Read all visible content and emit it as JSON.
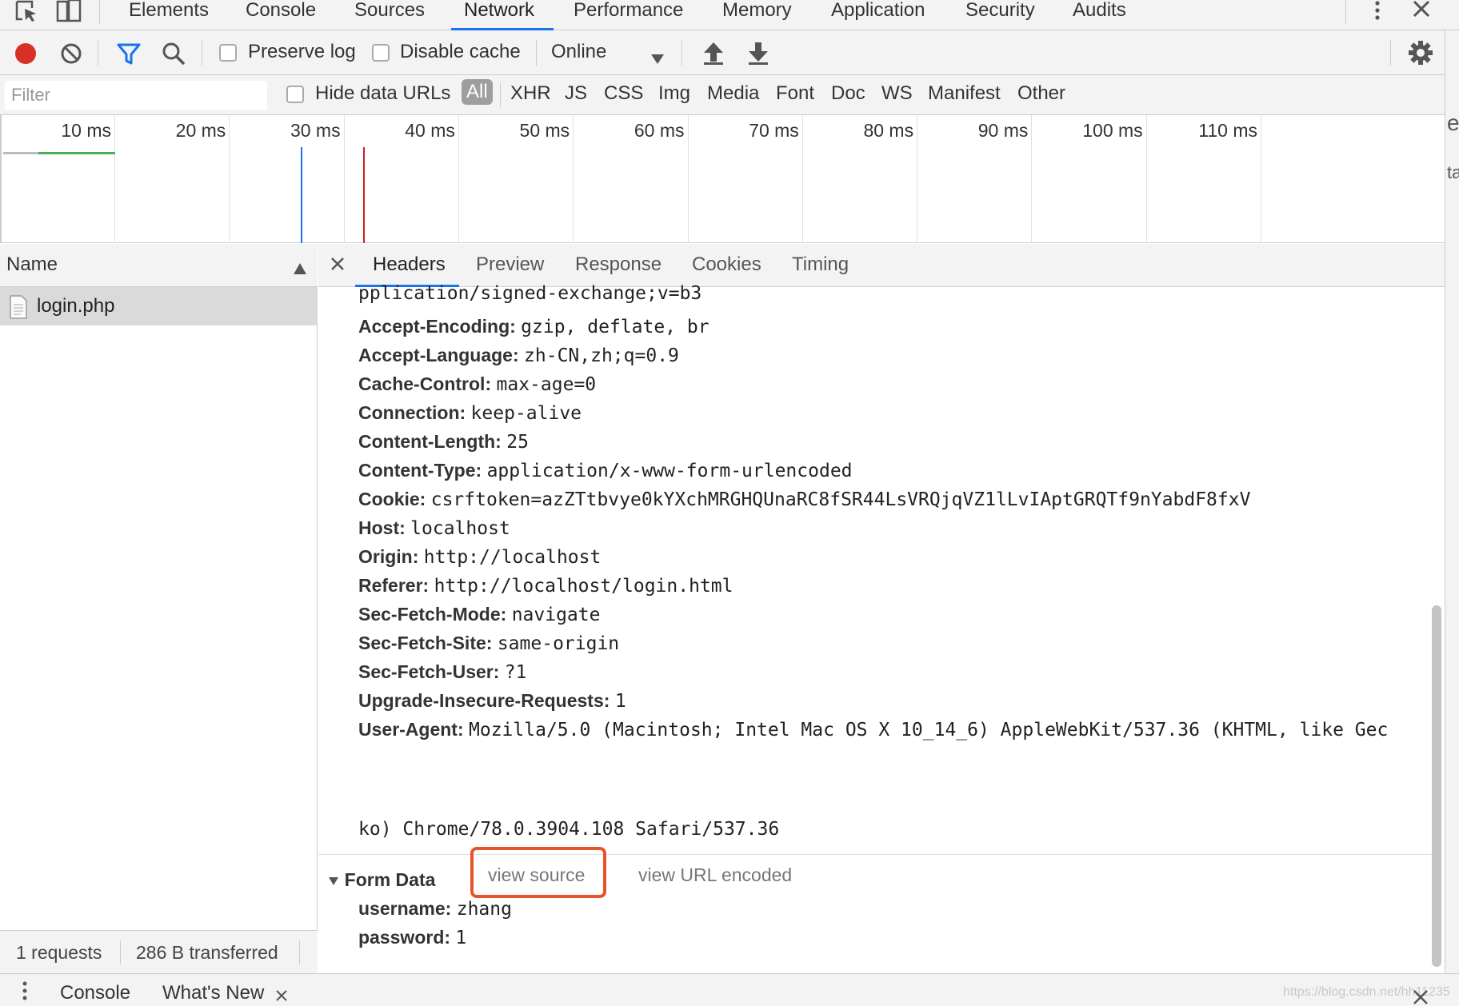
{
  "tabbar": {
    "tabs": [
      "Elements",
      "Console",
      "Sources",
      "Network",
      "Performance",
      "Memory",
      "Application",
      "Security",
      "Audits"
    ],
    "active_tab": "Network",
    "accent_color": "#1a73e8"
  },
  "toolbar": {
    "preserve_log_label": "Preserve log",
    "disable_cache_label": "Disable cache",
    "throttling_value": "Online",
    "record_color": "#d93025"
  },
  "filterbar": {
    "filter_placeholder": "Filter",
    "hide_data_urls_label": "Hide data URLs",
    "types": [
      "All",
      "XHR",
      "JS",
      "CSS",
      "Img",
      "Media",
      "Font",
      "Doc",
      "WS",
      "Manifest",
      "Other"
    ],
    "selected_type": "All"
  },
  "overview": {
    "tick_labels": [
      "10 ms",
      "20 ms",
      "30 ms",
      "40 ms",
      "50 ms",
      "60 ms",
      "70 ms",
      "80 ms",
      "90 ms",
      "100 ms",
      "110 ms"
    ],
    "dom_content_loaded_color": "#1a73e8",
    "load_color": "#c5221f",
    "bar_color": "#4caf50"
  },
  "requests": {
    "name_column_header": "Name",
    "items": [
      {
        "name": "login.php"
      }
    ],
    "status_requests": "1 requests",
    "status_transferred": "286 B transferred"
  },
  "details": {
    "tabs": [
      "Headers",
      "Preview",
      "Response",
      "Cookies",
      "Timing"
    ],
    "active_tab": "Headers",
    "truncated_line": "pplication/signed-exchange;v=b3",
    "request_headers": [
      {
        "key": "Accept-Encoding:",
        "value": "gzip, deflate, br"
      },
      {
        "key": "Accept-Language:",
        "value": "zh-CN,zh;q=0.9"
      },
      {
        "key": "Cache-Control:",
        "value": "max-age=0"
      },
      {
        "key": "Connection:",
        "value": "keep-alive"
      },
      {
        "key": "Content-Length:",
        "value": "25"
      },
      {
        "key": "Content-Type:",
        "value": "application/x-www-form-urlencoded"
      },
      {
        "key": "Cookie:",
        "value": "csrftoken=azZTtbvye0kYXchMRGHQUnaRC8fSR44LsVRQjqVZ1lLvIAptGRQTf9nYabdF8fxV"
      },
      {
        "key": "Host:",
        "value": "localhost"
      },
      {
        "key": "Origin:",
        "value": "http://localhost"
      },
      {
        "key": "Referer:",
        "value": "http://localhost/login.html"
      },
      {
        "key": "Sec-Fetch-Mode:",
        "value": "navigate"
      },
      {
        "key": "Sec-Fetch-Site:",
        "value": "same-origin"
      },
      {
        "key": "Sec-Fetch-User:",
        "value": "?1"
      },
      {
        "key": "Upgrade-Insecure-Requests:",
        "value": "1"
      },
      {
        "key": "User-Agent:",
        "value": "Mozilla/5.0 (Macintosh; Intel Mac OS X 10_14_6) AppleWebKit/537.36 (KHTML, like Gec"
      }
    ],
    "user_agent_continuation": "ko) Chrome/78.0.3904.108 Safari/537.36",
    "form_data": {
      "title": "Form Data",
      "view_source_label": "view source",
      "view_url_encoded_label": "view URL encoded",
      "highlight_color": "#e8532b",
      "fields": [
        {
          "key": "username:",
          "value": "zhang"
        },
        {
          "key": "password:",
          "value": "1"
        }
      ]
    }
  },
  "drawer": {
    "tabs": [
      "Console",
      "What's New"
    ]
  },
  "watermark": "https://blog.csdn.net/hh11235"
}
